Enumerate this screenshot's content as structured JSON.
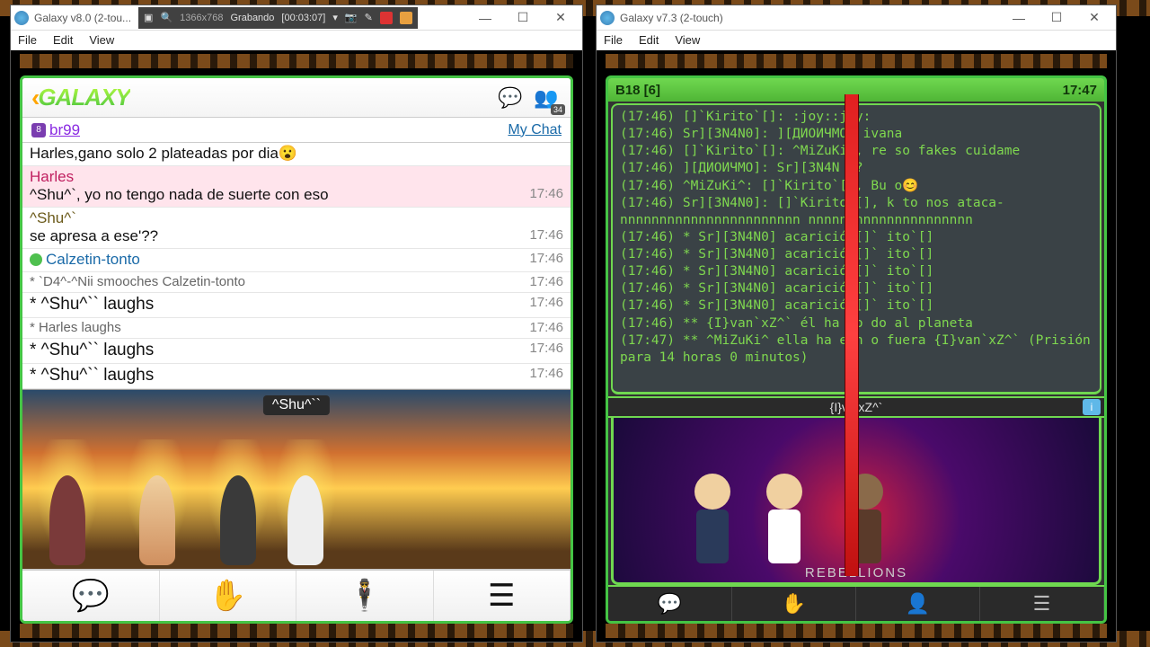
{
  "windowLeft": {
    "title": "Galaxy v8.0 (2-tou...",
    "recorder": {
      "dims": "1366x768",
      "label": "Grabando",
      "time": "[00:03:07]"
    },
    "menu": [
      "File",
      "Edit",
      "View"
    ]
  },
  "windowRight": {
    "title": "Galaxy v7.3 (2-touch)",
    "menu": [
      "File",
      "Edit",
      "View"
    ]
  },
  "leftApp": {
    "logo": "GALAXY",
    "peopleBadge": "34",
    "roomBadge": "8",
    "roomName": "br99",
    "myChat": "My Chat",
    "headline": "Harles,gano solo 2 plateadas por dia😮",
    "messages": [
      {
        "nick": "Harles",
        "txt": "^Shu^`, yo no tengo nada de suerte con eso",
        "time": "17:46",
        "hl": true
      },
      {
        "nick": "^Shu^`",
        "txt": "se apresa a ese'??",
        "time": "17:46",
        "nickColor": "olive"
      },
      {
        "nick": "",
        "txt": "Calzetin-tonto",
        "time": "17:46",
        "dot": true,
        "nickColor": "grey"
      },
      {
        "nick": "",
        "txt": "* `D4^-^Nii smooches Calzetin-tonto",
        "time": "17:46"
      },
      {
        "nick": "",
        "txt": "* ^Shu^`` laughs",
        "time": "17:46",
        "big": true
      },
      {
        "nick": "",
        "txt": "* Harles laughs",
        "time": "17:46"
      },
      {
        "nick": "",
        "txt": "* ^Shu^`` laughs",
        "time": "17:46",
        "big": true
      },
      {
        "nick": "",
        "txt": "* ^Shu^`` laughs",
        "time": "17:46",
        "big": true
      }
    ],
    "tag": "^Shu^``"
  },
  "rightApp": {
    "roomHeader": "B18 [6]",
    "clock": "17:47",
    "lines": [
      "(17:46) []`Kirito`[]: :joy::joy:",
      "(17:46) Sr][3N4N0]: ][ДИОИЧМО]   ivana",
      "(17:46) []`Kirito`[]: ^MiZuKi^, re   so fakes cuidame",
      "(17:46) ][ДИОИЧМО]: Sr][3N4N   ??",
      "(17:46) ^MiZuKi^: []`Kirito`[], Bu   o😊",
      "(17:46) Sr][3N4N0]: []`Kirito`[], k   to nos ataca-nnnnnnnnnnnnnnnnnnnnnnn  nnnnnnnnnnnnnnnnnnnnn",
      "(17:46) * Sr][3N4N0] acarició []`   ito`[]",
      "(17:46) * Sr][3N4N0] acarició []`   ito`[]",
      "(17:46) * Sr][3N4N0] acarició []`   ito`[]",
      "(17:46) * Sr][3N4N0] acarició []`   ito`[]",
      "(17:46) * Sr][3N4N0] acarició []`   ito`[]",
      "(17:46) ** {I}van`xZ^` él ha vo   do al planeta",
      "(17:47) ** ^MiZuKi^ ella ha ech   o fuera {I}van`xZ^` (Prisión para 14 horas 0 minutos)"
    ],
    "tag": "{I}va  xZ^`",
    "scene": "REBELLIONS"
  }
}
